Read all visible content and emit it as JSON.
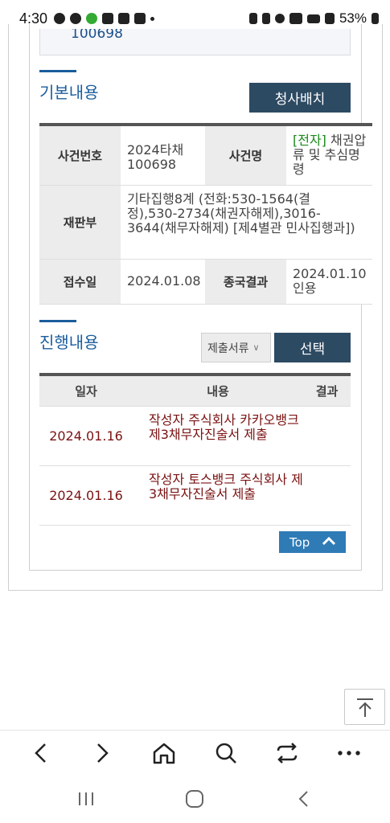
{
  "status_bar": {
    "time": "4:30",
    "battery": "53%"
  },
  "top_cell": {
    "text": "100698"
  },
  "basic_section": {
    "title": "기본내용",
    "button_label": "청사배치"
  },
  "basic_info": {
    "case_number_label": "사건번호",
    "case_number_value": "2024타채 100698",
    "case_name_label": "사건명",
    "case_name_tag": "[전자]",
    "case_name_value": "채권압류 및 추심명령",
    "court_label": "재판부",
    "court_value": "기타집행8계 (전화:530-1564(결정),530-2734(채권자해제),3016-3644(채무자해제) [제4별관 민사집행과])",
    "received_label": "접수일",
    "received_value": "2024.01.08",
    "result_label": "종국결과",
    "result_value": "2024.01.10 인용"
  },
  "progress_section": {
    "title": "진행내용",
    "select_value": "제출서류",
    "select_button": "선택"
  },
  "progress_table": {
    "headers": [
      "일자",
      "내용",
      "결과"
    ],
    "rows": [
      {
        "date": "2024.01.16",
        "content": "작성자 주식회사 카카오뱅크 제3채무자진술서 제출",
        "result": ""
      },
      {
        "date": "2024.01.16",
        "content": "작성자 토스뱅크 주식회사 제3채무자진술서 제출",
        "result": ""
      }
    ]
  },
  "top_button": {
    "label": "Top"
  },
  "icons": {
    "scroll_top": "arrow-up-to-line-icon",
    "back": "chevron-left-icon",
    "forward": "chevron-right-icon",
    "home": "home-icon",
    "search": "search-icon",
    "tabs": "tabs-switch-icon",
    "menu": "more-icon"
  },
  "colors": {
    "accent_blue": "#1a5d9c",
    "navy_button": "#2d4a63",
    "top_button": "#2f7bb6",
    "entry_text": "#7a1212",
    "tag_green": "#1a8a1a"
  }
}
